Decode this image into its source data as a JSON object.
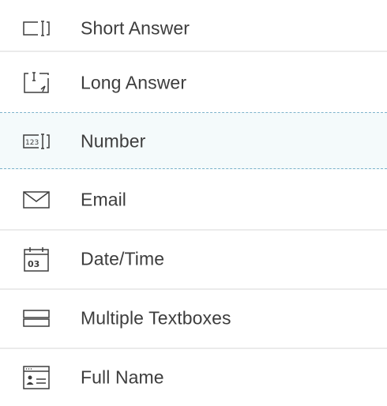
{
  "field_types": {
    "items": [
      {
        "label": "Short Answer",
        "icon": "short-answer-icon"
      },
      {
        "label": "Long Answer",
        "icon": "long-answer-icon"
      },
      {
        "label": "Number",
        "icon": "number-icon",
        "icon_text": "123"
      },
      {
        "label": "Email",
        "icon": "email-icon"
      },
      {
        "label": "Date/Time",
        "icon": "calendar-icon",
        "icon_text": "03"
      },
      {
        "label": "Multiple Textboxes",
        "icon": "multiple-textboxes-icon"
      },
      {
        "label": "Full Name",
        "icon": "full-name-icon"
      }
    ]
  },
  "colors": {
    "text": "#3d3d3d",
    "icon": "#3d3d3d",
    "divider": "#ebebeb",
    "highlight_bg": "#f4fafb",
    "highlight_border": "#7fb4cc"
  }
}
